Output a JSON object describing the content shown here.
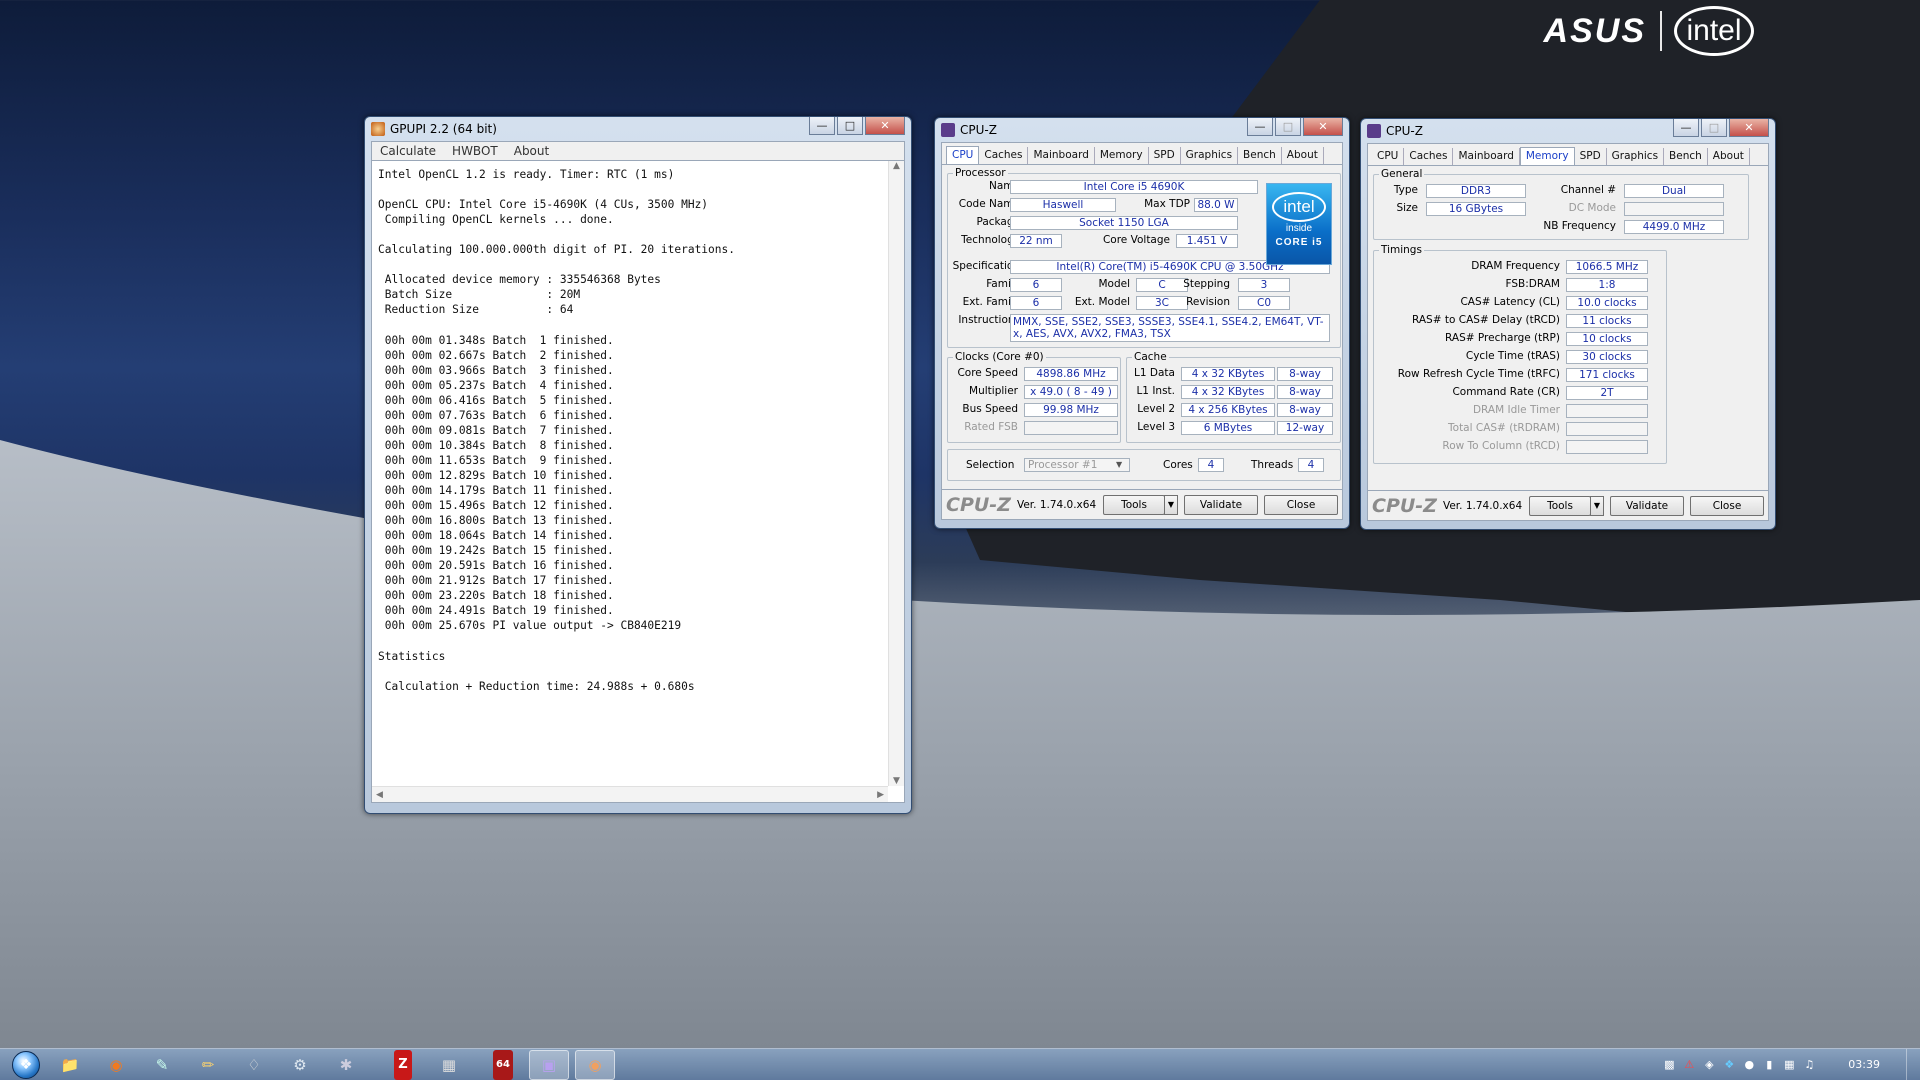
{
  "desktop": {
    "brand_left": "ASUS",
    "brand_right": "intel"
  },
  "gpupi": {
    "title": "GPUPI 2.2 (64 bit)",
    "menu": [
      "Calculate",
      "HWBOT",
      "About"
    ],
    "output": "Intel OpenCL 1.2 is ready. Timer: RTC (1 ms)\n\nOpenCL CPU: Intel Core i5-4690K (4 CUs, 3500 MHz)\n Compiling OpenCL kernels ... done.\n\nCalculating 100.000.000th digit of PI. 20 iterations.\n\n Allocated device memory : 335546368 Bytes\n Batch Size              : 20M\n Reduction Size          : 64\n\n 00h 00m 01.348s Batch  1 finished.\n 00h 00m 02.667s Batch  2 finished.\n 00h 00m 03.966s Batch  3 finished.\n 00h 00m 05.237s Batch  4 finished.\n 00h 00m 06.416s Batch  5 finished.\n 00h 00m 07.763s Batch  6 finished.\n 00h 00m 09.081s Batch  7 finished.\n 00h 00m 10.384s Batch  8 finished.\n 00h 00m 11.653s Batch  9 finished.\n 00h 00m 12.829s Batch 10 finished.\n 00h 00m 14.179s Batch 11 finished.\n 00h 00m 15.496s Batch 12 finished.\n 00h 00m 16.800s Batch 13 finished.\n 00h 00m 18.064s Batch 14 finished.\n 00h 00m 19.242s Batch 15 finished.\n 00h 00m 20.591s Batch 16 finished.\n 00h 00m 21.912s Batch 17 finished.\n 00h 00m 23.220s Batch 18 finished.\n 00h 00m 24.491s Batch 19 finished.\n 00h 00m 25.670s PI value output -> CB840E219\n\nStatistics\n\n Calculation + Reduction time: 24.988s + 0.680s"
  },
  "cpuz_cpu": {
    "title": "CPU-Z",
    "tabs": [
      "CPU",
      "Caches",
      "Mainboard",
      "Memory",
      "SPD",
      "Graphics",
      "Bench",
      "About"
    ],
    "processor": {
      "group": "Processor",
      "name_label": "Name",
      "name": "Intel Core i5 4690K",
      "codename_label": "Code Name",
      "codename": "Haswell",
      "maxtdp_label": "Max TDP",
      "maxtdp": "88.0 W",
      "package_label": "Package",
      "package": "Socket 1150 LGA",
      "technology_label": "Technology",
      "technology": "22 nm",
      "voltage_label": "Core Voltage",
      "voltage": "1.451 V",
      "spec_label": "Specification",
      "spec": "Intel(R) Core(TM) i5-4690K CPU @ 3.50GHz",
      "family_label": "Family",
      "family": "6",
      "model_label": "Model",
      "model": "C",
      "stepping_label": "Stepping",
      "stepping": "3",
      "extfamily_label": "Ext. Family",
      "extfamily": "6",
      "extmodel_label": "Ext. Model",
      "extmodel": "3C",
      "revision_label": "Revision",
      "revision": "C0",
      "instructions_label": "Instructions",
      "instructions": "MMX, SSE, SSE2, SSE3, SSSE3, SSE4.1, SSE4.2, EM64T, VT-x, AES, AVX, AVX2, FMA3, TSX"
    },
    "badge": {
      "ring": "intel",
      "inside": "inside",
      "core": "CORE i5"
    },
    "clocks": {
      "group": "Clocks (Core #0)",
      "speed_label": "Core Speed",
      "speed": "4898.86 MHz",
      "mult_label": "Multiplier",
      "mult": "x 49.0 ( 8 - 49 )",
      "bus_label": "Bus Speed",
      "bus": "99.98 MHz",
      "fsb_label": "Rated FSB",
      "fsb": ""
    },
    "cache": {
      "group": "Cache",
      "l1d_label": "L1 Data",
      "l1d": "4 x 32 KBytes",
      "l1d_way": "8-way",
      "l1i_label": "L1 Inst.",
      "l1i": "4 x 32 KBytes",
      "l1i_way": "8-way",
      "l2_label": "Level 2",
      "l2": "4 x 256 KBytes",
      "l2_way": "8-way",
      "l3_label": "Level 3",
      "l3": "6 MBytes",
      "l3_way": "12-way"
    },
    "selection_label": "Selection",
    "selection": "Processor #1",
    "cores_label": "Cores",
    "cores": "4",
    "threads_label": "Threads",
    "threads": "4",
    "footer": {
      "logo": "CPU-Z",
      "version": "Ver. 1.74.0.x64",
      "tools": "Tools",
      "validate": "Validate",
      "close": "Close"
    }
  },
  "cpuz_mem": {
    "title": "CPU-Z",
    "tabs": [
      "CPU",
      "Caches",
      "Mainboard",
      "Memory",
      "SPD",
      "Graphics",
      "Bench",
      "About"
    ],
    "general": {
      "group": "General",
      "type_label": "Type",
      "type": "DDR3",
      "channel_label": "Channel #",
      "channel": "Dual",
      "size_label": "Size",
      "size": "16 GBytes",
      "dcmode_label": "DC Mode",
      "dcmode": "",
      "nbfreq_label": "NB Frequency",
      "nbfreq": "4499.0 MHz"
    },
    "timings": {
      "group": "Timings",
      "rows": [
        {
          "label": "DRAM Frequency",
          "value": "1066.5 MHz"
        },
        {
          "label": "FSB:DRAM",
          "value": "1:8"
        },
        {
          "label": "CAS# Latency (CL)",
          "value": "10.0 clocks"
        },
        {
          "label": "RAS# to CAS# Delay (tRCD)",
          "value": "11 clocks"
        },
        {
          "label": "RAS# Precharge (tRP)",
          "value": "10 clocks"
        },
        {
          "label": "Cycle Time (tRAS)",
          "value": "30 clocks"
        },
        {
          "label": "Row Refresh Cycle Time (tRFC)",
          "value": "171 clocks"
        },
        {
          "label": "Command Rate (CR)",
          "value": "2T"
        },
        {
          "label": "DRAM Idle Timer",
          "value": ""
        },
        {
          "label": "Total CAS# (tRDRAM)",
          "value": ""
        },
        {
          "label": "Row To Column (tRCD)",
          "value": ""
        }
      ]
    },
    "footer": {
      "logo": "CPU-Z",
      "version": "Ver. 1.74.0.x64",
      "tools": "Tools",
      "validate": "Validate",
      "close": "Close"
    }
  },
  "taskbar": {
    "pinned": [
      "folder-icon",
      "firefox-icon",
      "notepad-icon",
      "pencil-icon",
      "bag-icon",
      "steam-icon",
      "tool-icon",
      "z-icon",
      "calendar-icon",
      "64-icon",
      "cpuz-icon",
      "gpupi-icon"
    ],
    "z_text": "Z",
    "b64_text": "64",
    "clock": "03:39"
  },
  "colors": {
    "accent": "#1a3fc8",
    "close": "#c4504a",
    "value_text": "#1b2fa8"
  }
}
